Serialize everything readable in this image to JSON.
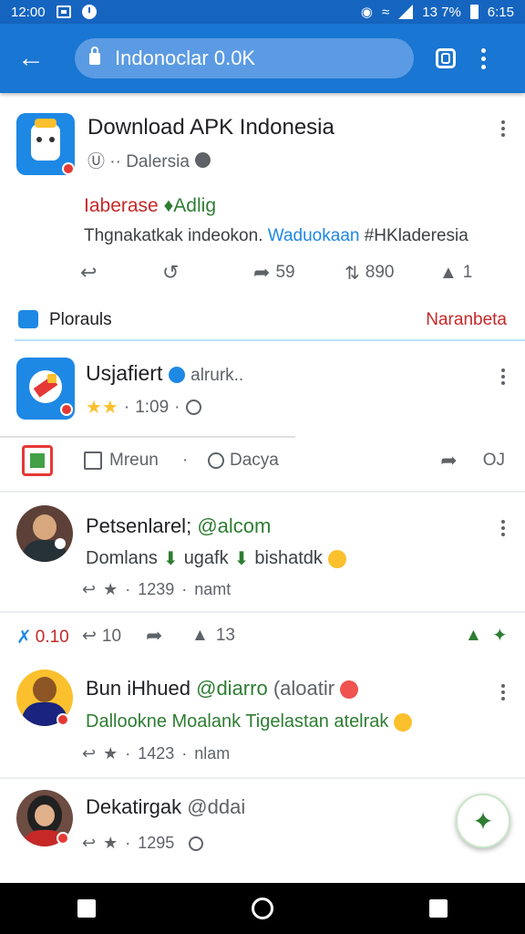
{
  "status": {
    "time_left": "12:00",
    "battery_text": "13 7%",
    "time_right": "6:15"
  },
  "appbar": {
    "url": "Indonoclar 0.0K"
  },
  "featured": {
    "title": "Download APK Indonesia",
    "meta": "Ⓤ ·· Dalersia",
    "headline_red": "Iaberase",
    "headline_green": "Adlig",
    "desc_a": "Thgnakatkak indeokon.",
    "desc_b": "Waduokaan",
    "desc_c": "#HKladeresia",
    "count_2": "59",
    "count_3": "890",
    "count_4": "1"
  },
  "section": {
    "label": "Plorauls",
    "right_link": "Naranbeta"
  },
  "app_post": {
    "title": "Usjafiert",
    "handle": "alrurk..",
    "rating_count": "1:09",
    "tag1": "Mreun",
    "tag2": "Dacya",
    "share_count": "OJ"
  },
  "post1": {
    "name": "Petsenlarel;",
    "handle": "@alcom",
    "line_a": "Domlans",
    "line_b": "ugafk",
    "line_c": "bishatdk",
    "count": "1239",
    "time": "namt"
  },
  "stats_row": {
    "a": "0.10",
    "b": "10",
    "c": "13"
  },
  "post2": {
    "name": "Bun iHhued",
    "handle": "@diarro",
    "extra": "(aloatir",
    "line": "Dallookne Moalank Tigelastan atelrak",
    "count": "1423",
    "time": "nlam"
  },
  "post3": {
    "name": "Dekatirgak",
    "handle": "@ddai",
    "count": "1295"
  },
  "colors": {
    "primary": "#1976d2",
    "red": "#c62828",
    "green": "#2e7d32",
    "link": "#1e88e5"
  }
}
